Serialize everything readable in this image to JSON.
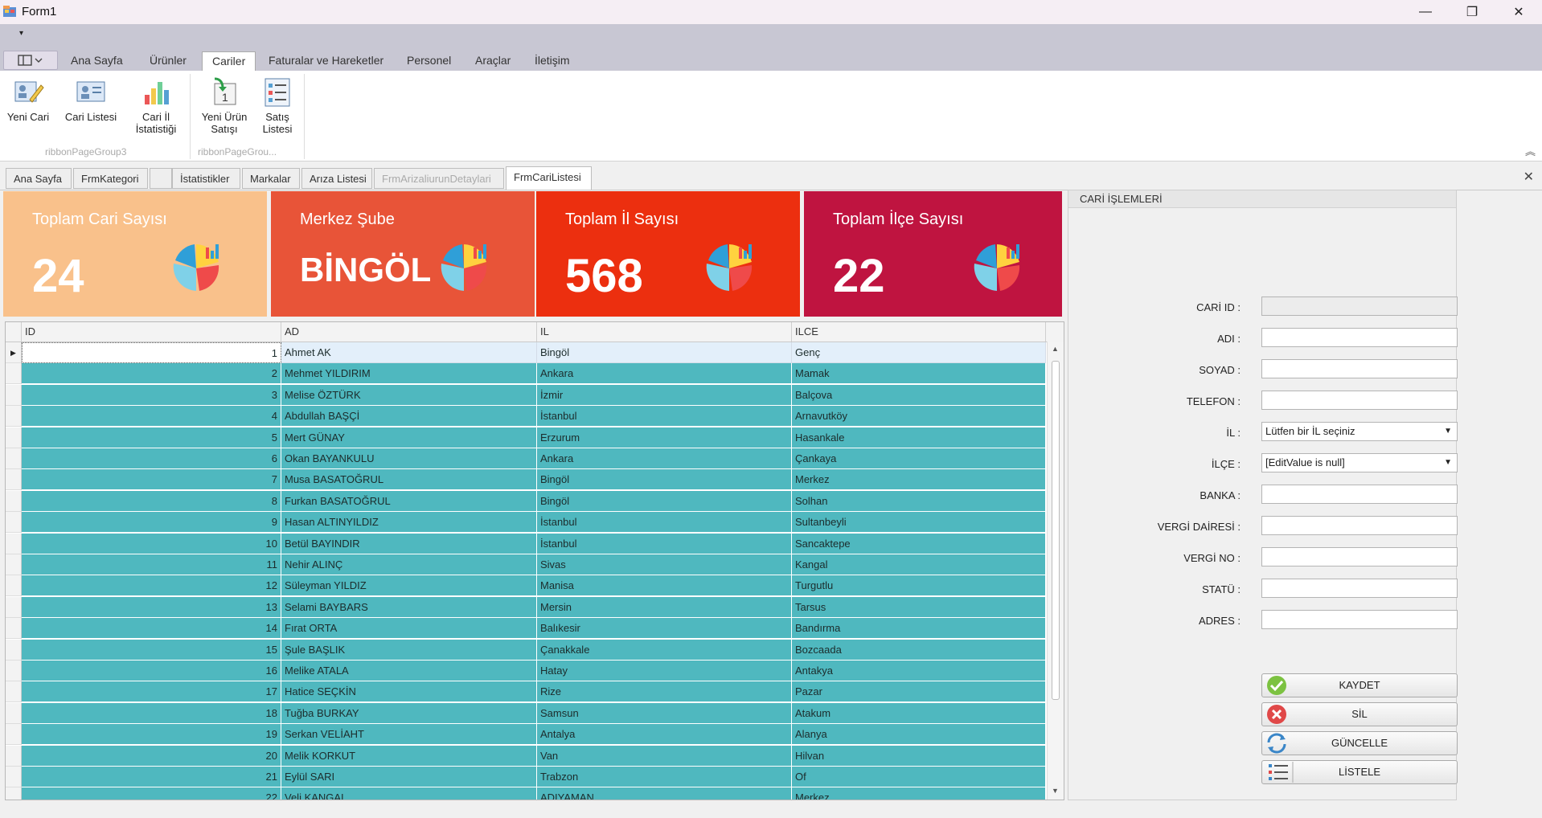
{
  "window": {
    "title": "Form1",
    "minimize": "—",
    "maximize": "❐",
    "close": "✕"
  },
  "qat": {
    "dropdown": "▾"
  },
  "ribbon": {
    "tabs": [
      "Ana Sayfa",
      "Ürünler",
      "Cariler",
      "Faturalar ve Hareketler",
      "Personel",
      "Araçlar",
      "İletişim"
    ],
    "active_tab": "Cariler",
    "buttons": [
      {
        "label": "Yeni Cari",
        "icon": "edit-card-icon"
      },
      {
        "label": "Cari Listesi",
        "icon": "id-card-icon"
      },
      {
        "label": "Cari İl İstatistiği",
        "icon": "bar-chart-icon"
      },
      {
        "label": "Yeni Ürün Satışı",
        "icon": "arrow-one-icon"
      },
      {
        "label": "Satış Listesi",
        "icon": "list-icon"
      }
    ],
    "groups": [
      "ribbonPageGroup3",
      "ribbonPageGrou..."
    ],
    "collapse": "︽"
  },
  "doc_tabs": {
    "items": [
      "Ana Sayfa",
      "FrmKategori",
      "",
      "İstatistikler",
      "Markalar",
      "Arıza Listesi",
      "FrmArizaliurunDetaylari",
      "FrmCariListesi"
    ],
    "active": "FrmCariListesi",
    "close": "✕"
  },
  "tiles": [
    {
      "caption": "Toplam Cari Sayısı",
      "value": "24",
      "color": "#f9c18b"
    },
    {
      "caption": "Merkez Şube",
      "value": "BİNGÖL",
      "color": "#e85438"
    },
    {
      "caption": "Toplam İl Sayısı",
      "value": "568",
      "color": "#ec2f0f"
    },
    {
      "caption": "Toplam İlçe Sayısı",
      "value": "22",
      "color": "#bf1440"
    }
  ],
  "grid": {
    "columns": [
      "ID",
      "AD",
      "IL",
      "ILCE"
    ],
    "rows": [
      [
        "1",
        "Ahmet AK",
        "Bingöl",
        "Genç"
      ],
      [
        "2",
        "Mehmet YILDIRIM",
        "Ankara",
        "Mamak"
      ],
      [
        "3",
        "Melise ÖZTÜRK",
        "İzmir",
        "Balçova"
      ],
      [
        "4",
        "Abdullah BAŞÇİ",
        "İstanbul",
        "Arnavutköy"
      ],
      [
        "5",
        "Mert GÜNAY",
        "Erzurum",
        "Hasankale"
      ],
      [
        "6",
        "Okan BAYANKULU",
        "Ankara",
        "Çankaya"
      ],
      [
        "7",
        "Musa BASATOĞRUL",
        "Bingöl",
        "Merkez"
      ],
      [
        "8",
        "Furkan BASATOĞRUL",
        "Bingöl",
        "Solhan"
      ],
      [
        "9",
        "Hasan ALTINYILDIZ",
        "İstanbul",
        "Sultanbeyli"
      ],
      [
        "10",
        "Betül BAYINDIR",
        "İstanbul",
        "Sancaktepe"
      ],
      [
        "11",
        "Nehir ALINÇ",
        "Sivas",
        "Kangal"
      ],
      [
        "12",
        "Süleyman  YILDIZ",
        "Manisa",
        "Turgutlu"
      ],
      [
        "13",
        "Selami BAYBARS",
        "Mersin",
        "Tarsus"
      ],
      [
        "14",
        "Fırat ORTA",
        "Balıkesir",
        "Bandırma"
      ],
      [
        "15",
        "Şule BAŞLIK",
        "Çanakkale",
        "Bozcaada"
      ],
      [
        "16",
        "Melike ATALA",
        "Hatay",
        "Antakya"
      ],
      [
        "17",
        "Hatice SEÇKİN",
        "Rize",
        "Pazar"
      ],
      [
        "18",
        "Tuğba BURKAY",
        "Samsun",
        "Atakum"
      ],
      [
        "19",
        "Serkan VELİAHT",
        "Antalya",
        "Alanya"
      ],
      [
        "20",
        "Melik  KORKUT",
        "Van",
        "Hilvan"
      ],
      [
        "21",
        "Eylül SARI",
        "Trabzon",
        "Of"
      ],
      [
        "22",
        "Veli KANGAL",
        "ADIYAMAN",
        "Merkez"
      ]
    ]
  },
  "panel": {
    "title": "CARİ İŞLEMLERİ",
    "labels": {
      "id": "CARİ ID :",
      "adi": "ADI :",
      "soyad": "SOYAD :",
      "telefon": "TELEFON :",
      "il": "İL  :",
      "ilce": "İLÇE :",
      "banka": "BANKA  :",
      "vergi_dairesi": "VERGİ DAİRESİ :",
      "vergi_no": "VERGİ NO :",
      "statu": "STATÜ :",
      "adres": "ADRES :"
    },
    "values": {
      "id": "",
      "adi": "",
      "soyad": "",
      "telefon": "",
      "banka": "",
      "vergi_dairesi": "",
      "vergi_no": "",
      "statu": "",
      "adres": ""
    },
    "il_combo": "Lütfen bir İL seçiniz",
    "ilce_combo": "[EditValue is null]",
    "buttons": {
      "save": "KAYDET",
      "delete": "SİL",
      "update": "GÜNCELLE",
      "list": "LİSTELE"
    }
  }
}
